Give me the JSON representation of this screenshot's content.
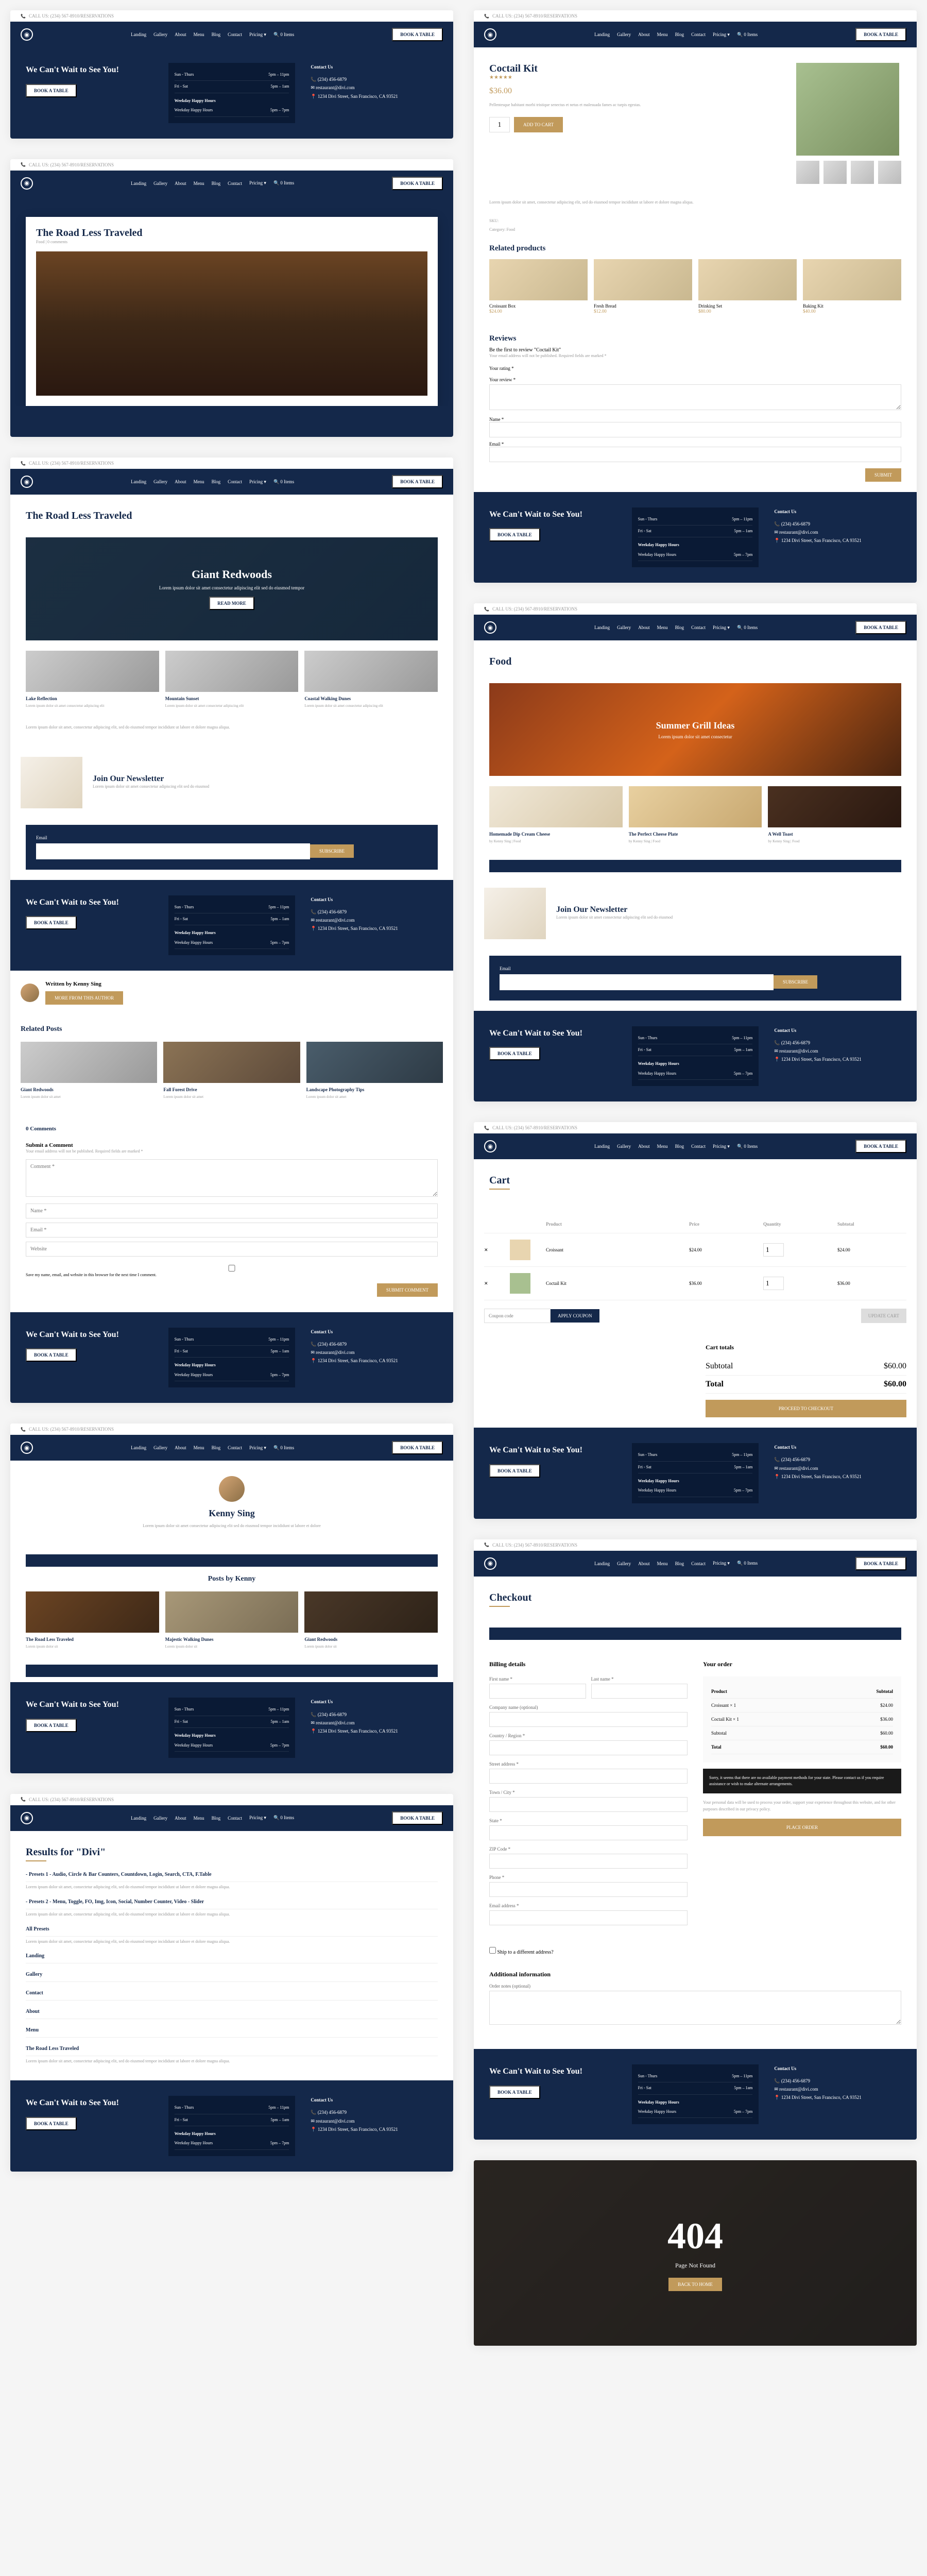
{
  "topbar": "CALL US: (234) 567-8910/RESERVATIONS",
  "nav": {
    "items": [
      "Landing",
      "Gallery",
      "About",
      "Menu",
      "Blog",
      "Contact",
      "Pricing ▾",
      "🔍 0 Items"
    ],
    "cta": "BOOK A TABLE"
  },
  "footer": {
    "title": "We Can't Wait to See You!",
    "btn": "BOOK A TABLE",
    "hoursTitle": "Weekday Happy Hours",
    "hours": [
      [
        "Sun - Thurs",
        "5pm – 11pm"
      ],
      [
        "Fri - Sat",
        "5pm – 1am"
      ],
      [
        "Weekday Happy Hours",
        "5pm – 7pm"
      ]
    ],
    "contactTitle": "Contact Us",
    "phone": "(234) 456-6879",
    "email": "restaurant@divi.com",
    "address": "1234 Divi Street, San Francisco, CA 93521"
  },
  "s1": {
    "title": "The Road Less Traveled",
    "meta": "Food | 0 comments"
  },
  "s2": {
    "title": "The Road Less Traveled",
    "hero": "Giant Redwoods",
    "heroText": "Lorem ipsum dolor sit amet consectetur adipiscing elit sed do eiusmod tempor",
    "btn": "READ MORE",
    "cards": [
      {
        "t": "Lake Reflection",
        "d": "Lorem ipsum dolor sit amet consectetur adipiscing elit"
      },
      {
        "t": "Mountain Sunset",
        "d": "Lorem ipsum dolor sit amet consectetur adipiscing elit"
      },
      {
        "t": "Coastal Walking Dunes",
        "d": "Lorem ipsum dolor sit amet consectetur adipiscing elit"
      }
    ],
    "newsTitle": "Join Our Newsletter",
    "newsText": "Lorem ipsum dolor sit amet consectetur adipiscing elit sed do eiusmod",
    "emailLabel": "Email",
    "emailBtn": "SUBSCRIBE",
    "author": "Written by Kenny Sing",
    "authorBtn": "MORE FROM THIS AUTHOR",
    "relatedTitle": "Related Posts",
    "related": [
      {
        "t": "Giant Redwoods",
        "d": "Lorem ipsum dolor sit amet"
      },
      {
        "t": "Fall Forest Drive",
        "d": "Lorem ipsum dolor sit amet"
      },
      {
        "t": "Landscape Photography Tips",
        "d": "Lorem ipsum dolor sit amet"
      }
    ],
    "commentsTitle": "0 Comments",
    "submitTitle": "Submit a Comment",
    "submitNote": "Your email address will not be published. Required fields are marked *",
    "fields": [
      "Comment *",
      "Name *",
      "Email *",
      "Website"
    ],
    "saveCheck": "Save my name, email, and website in this browser for the next time I comment.",
    "submitBtn": "SUBMIT COMMENT"
  },
  "s3": {
    "name": "Kenny Sing",
    "bio": "Lorem ipsum dolor sit amet consectetur adipiscing elit sed do eiusmod tempor incididunt ut labore et dolore",
    "postsTitle": "Posts by Kenny",
    "posts": [
      {
        "t": "The Road Less Traveled",
        "d": "Lorem ipsum dolor sit"
      },
      {
        "t": "Majestic Walking Dunes",
        "d": "Lorem ipsum dolor sit"
      },
      {
        "t": "Giant Redwoods",
        "d": "Lorem ipsum dolor sit"
      }
    ]
  },
  "s4": {
    "title": "Results for \"Divi\"",
    "r1": "- Presets 1 - Audio, Circle & Bar Counters, Countdown, Login, Search, CTA, F.Table",
    "r2": "- Presets 2 - Menu, Toggle, FO, Img, Icon, Social, Number Counter, Video - Slider",
    "sections": [
      "All Presets",
      "Landing",
      "Gallery",
      "Contact",
      "About",
      "Menu",
      "The Road Less Traveled"
    ],
    "lorem": "Lorem ipsum dolor sit amet, consectetur adipiscing elit, sed do eiusmod tempor incididunt ut labore et dolore magna aliqua."
  },
  "p1": {
    "title": "Coctail Kit",
    "rating": "★★★★★",
    "price": "$36.00",
    "desc": "Pellentesque habitant morbi tristique senectus et netus et malesuada fames ac turpis egestas.",
    "qty": "1",
    "btn": "ADD TO CART",
    "sku": "SKU:",
    "cat": "Category: Food",
    "relTitle": "Related products",
    "related": [
      {
        "t": "Croissant Box",
        "p": "$24.00"
      },
      {
        "t": "Fresh Bread",
        "p": "$12.00"
      },
      {
        "t": "Drinking Set",
        "p": "$80.00"
      },
      {
        "t": "Baking Kit",
        "p": "$40.00"
      }
    ],
    "reviewsTitle": "Reviews",
    "reviewsSub": "Be the first to review \"Coctail Kit\"",
    "reviewNote": "Your email address will not be published. Required fields are marked *",
    "fields": [
      "Your rating *",
      "Your review *",
      "Name *",
      "Email *"
    ],
    "submit": "SUBMIT"
  },
  "p2": {
    "title": "Food",
    "hero": "Summer Grill Ideas",
    "heroText": "Lorem ipsum dolor sit amet consectetur",
    "posts": [
      {
        "t": "Homemade Dip Cream Cheese",
        "m": "by Kenny Sing | Food"
      },
      {
        "t": "The Perfect Cheese Plate",
        "m": "by Kenny Sing | Food"
      },
      {
        "t": "A Well Toast",
        "m": "by Kenny Sing | Food"
      }
    ],
    "newsTitle": "Join Our Newsletter"
  },
  "p3": {
    "title": "Cart",
    "headers": [
      "",
      "",
      "Product",
      "Price",
      "Quantity",
      "Subtotal"
    ],
    "items": [
      {
        "n": "Croissant",
        "p": "$24.00",
        "q": "1",
        "s": "$24.00"
      },
      {
        "n": "Coctail Kit",
        "p": "$36.00",
        "q": "1",
        "s": "$36.00"
      }
    ],
    "coupon": "Coupon code",
    "applyBtn": "APPLY COUPON",
    "updateBtn": "UPDATE CART",
    "totalsTitle": "Cart totals",
    "subtotal": [
      "Subtotal",
      "$60.00"
    ],
    "total": [
      "Total",
      "$60.00"
    ],
    "checkoutBtn": "PROCEED TO CHECKOUT"
  },
  "p4": {
    "title": "Checkout",
    "billingTitle": "Billing details",
    "fields": [
      "First name *",
      "Last name *",
      "Company name (optional)",
      "Country / Region *",
      "Street address *",
      "Town / City *",
      "State *",
      "ZIP Code *",
      "Phone *",
      "Email address *"
    ],
    "shipCheck": "Ship to a different address?",
    "addTitle": "Additional information",
    "notesLabel": "Order notes (optional)",
    "orderTitle": "Your order",
    "orderRows": [
      [
        "Product",
        "Subtotal"
      ],
      [
        "Croissant × 1",
        "$24.00"
      ],
      [
        "Coctail Kit × 1",
        "$36.00"
      ],
      [
        "Subtotal",
        "$60.00"
      ],
      [
        "Total",
        "$60.00"
      ]
    ],
    "payNote": "Sorry, it seems that there are no available payment methods for your state. Please contact us if you require assistance or wish to make alternate arrangements.",
    "privacy": "Your personal data will be used to process your order, support your experience throughout this website, and for other purposes described in our privacy policy.",
    "placeBtn": "PLACE ORDER"
  },
  "p5": {
    "code": "404",
    "msg": "Page Not Found",
    "btn": "BACK TO HOME"
  }
}
